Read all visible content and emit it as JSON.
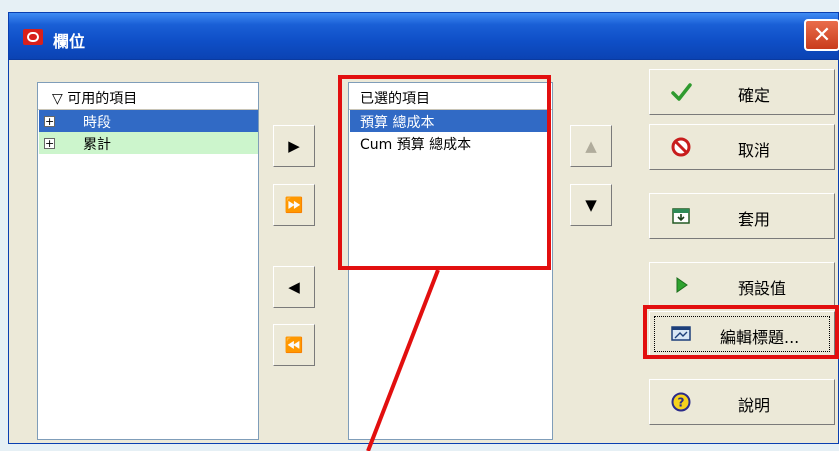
{
  "window": {
    "title": "欄位"
  },
  "available": {
    "header": "▽ 可用的項目",
    "items": [
      {
        "expander": "+",
        "label": "時段",
        "state": "selected"
      },
      {
        "expander": "+",
        "label": "累計",
        "state": "highlighted"
      }
    ]
  },
  "selected": {
    "header": "已選的項目",
    "items": [
      "預算 總成本",
      "Cum 預算 總成本"
    ]
  },
  "movers": {
    "add": "▶",
    "add_all": "⏩",
    "remove": "◀",
    "remove_all": "⏪",
    "up": "▲",
    "down": "▼"
  },
  "actions": [
    {
      "label": "確定",
      "icon": "checkmark-icon"
    },
    {
      "label": "取消",
      "icon": "no-entry-icon"
    },
    {
      "label": "套用",
      "icon": "apply-icon"
    },
    {
      "label": "預設值",
      "icon": "play-icon"
    },
    {
      "label": "編輯標題...",
      "icon": "edit-title-icon"
    },
    {
      "label": "說明",
      "icon": "help-icon"
    }
  ],
  "colors": {
    "titlebar": "#0f4fc7",
    "selection": "#316ac5",
    "highlight_row": "#ccf5cc",
    "callout": "#e20f0f"
  }
}
